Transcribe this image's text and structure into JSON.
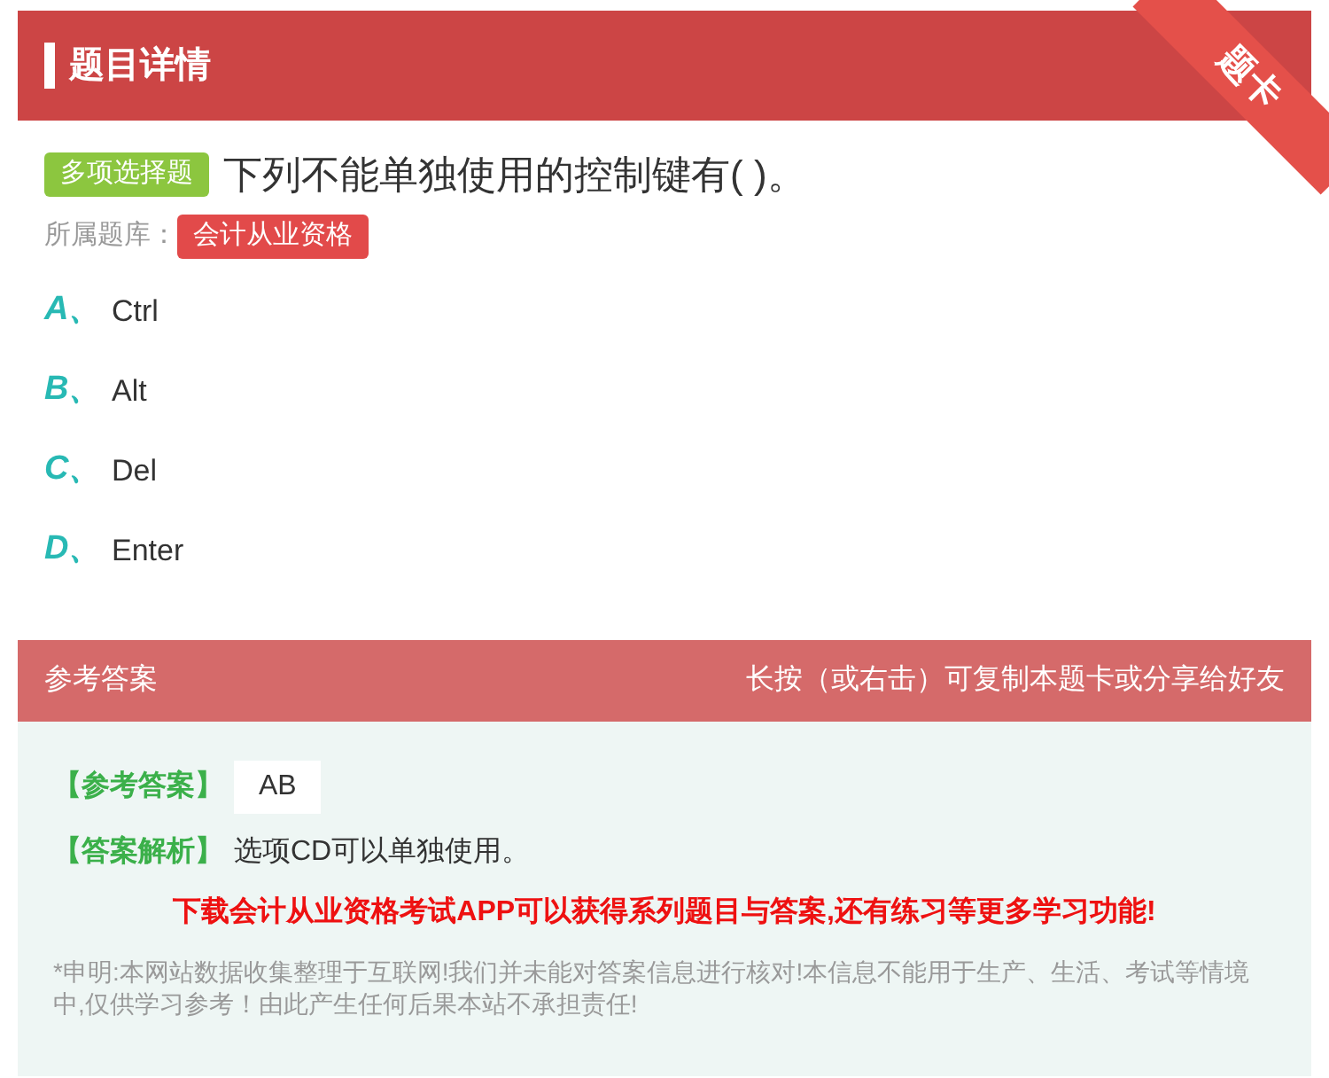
{
  "header": {
    "title": "题目详情",
    "ribbon": "题卡"
  },
  "question": {
    "type_badge": "多项选择题",
    "text": "下列不能单独使用的控制键有( )。",
    "bank_label": "所属题库：",
    "bank": "会计从业资格"
  },
  "options": [
    {
      "letter": "A、",
      "text": "Ctrl"
    },
    {
      "letter": "B、",
      "text": "Alt"
    },
    {
      "letter": "C、",
      "text": "Del"
    },
    {
      "letter": "D、",
      "text": "Enter"
    }
  ],
  "answer_section": {
    "title": "参考答案",
    "hint": "长按（或右击）可复制本题卡或分享给好友",
    "answer_label": "【参考答案】",
    "answer": "AB",
    "analysis_label": "【答案解析】",
    "analysis": "选项CD可以单独使用。",
    "promo": "下载会计从业资格考试APP可以获得系列题目与答案,还有练习等更多学习功能!",
    "disclaimer": "*申明:本网站数据收集整理于互联网!我们并未能对答案信息进行核对!本信息不能用于生产、生活、考试等情境中,仅供学习参考！由此产生任何后果本站不承担责任!"
  }
}
